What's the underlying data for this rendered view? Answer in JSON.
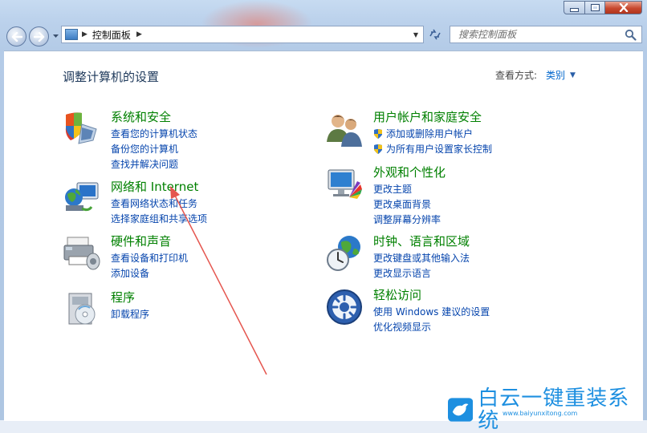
{
  "window": {
    "address": {
      "crumb": "控制面板"
    },
    "search": {
      "placeholder": "搜索控制面板"
    }
  },
  "header": {
    "title": "调整计算机的设置",
    "view_by_label": "查看方式:",
    "view_by_value": "类别"
  },
  "categories": [
    {
      "title": "系统和安全",
      "links": [
        "查看您的计算机状态",
        "备份您的计算机",
        "查找并解决问题"
      ]
    },
    {
      "title": "网络和 Internet",
      "links": [
        "查看网络状态和任务",
        "选择家庭组和共享选项"
      ]
    },
    {
      "title": "硬件和声音",
      "links": [
        "查看设备和打印机",
        "添加设备"
      ]
    },
    {
      "title": "程序",
      "links": [
        "卸载程序"
      ]
    },
    {
      "title": "用户帐户和家庭安全",
      "links": [
        "添加或删除用户帐户",
        "为所有用户设置家长控制"
      ]
    },
    {
      "title": "外观和个性化",
      "links": [
        "更改主题",
        "更改桌面背景",
        "调整屏幕分辨率"
      ]
    },
    {
      "title": "时钟、语言和区域",
      "links": [
        "更改键盘或其他输入法",
        "更改显示语言"
      ]
    },
    {
      "title": "轻松访问",
      "links": [
        "使用 Windows 建议的设置",
        "优化视频显示"
      ]
    }
  ],
  "watermark": {
    "text": "白云一键重装系统",
    "url": "www.baiyunxitong.com"
  },
  "colors": {
    "category_title": "#008000",
    "link": "#0645ad",
    "title": "#1e395b",
    "annotation_arrow": "#e5564f",
    "watermark": "#1d8fe0"
  },
  "icons": [
    "back-arrow-icon",
    "forward-arrow-icon",
    "control-panel-icon",
    "refresh-icon",
    "search-icon",
    "system-security-icon",
    "network-icon",
    "hardware-sound-icon",
    "programs-icon",
    "user-accounts-icon",
    "appearance-icon",
    "clock-globe-icon",
    "ease-of-access-icon",
    "uac-shield-icon"
  ]
}
